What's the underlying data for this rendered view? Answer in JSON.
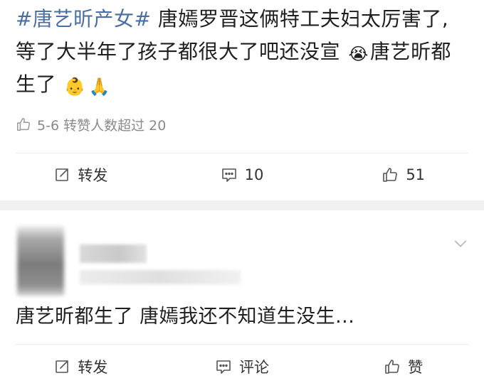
{
  "post": {
    "hashtag": "#唐艺昕产女#",
    "text_line1": " 唐嫣罗晋这俩特工夫妇太厉害了,",
    "text_line2": "等了大半年了孩子都很大了吧还没宣",
    "emoji_crying": "😭",
    "text_line3a": "唐艺昕都",
    "text_line3b": "生了",
    "emoji_baby": "👶",
    "emoji_hands": "🙏",
    "meta_text": "5-6 转赞人数超过 20",
    "actions": {
      "repost_label": "转发",
      "comment_count": "10",
      "like_count": "51"
    }
  },
  "comment": {
    "text": "唐艺昕都生了 唐嫣我还不知道生没生...",
    "actions": {
      "repost_label": "转发",
      "comment_label": "评论",
      "like_label": "赞"
    }
  },
  "icons": {
    "meta": "thumbs-up-outline-icon",
    "repost": "share-square-icon",
    "comment": "comment-bubble-icon",
    "like": "thumbs-up-icon",
    "expand": "chevron-down-icon"
  },
  "colors": {
    "hashtag": "#4a6fa5",
    "text": "#1f1f1f",
    "meta": "#8a8a8a",
    "separator_band": "#f1f1f1"
  }
}
